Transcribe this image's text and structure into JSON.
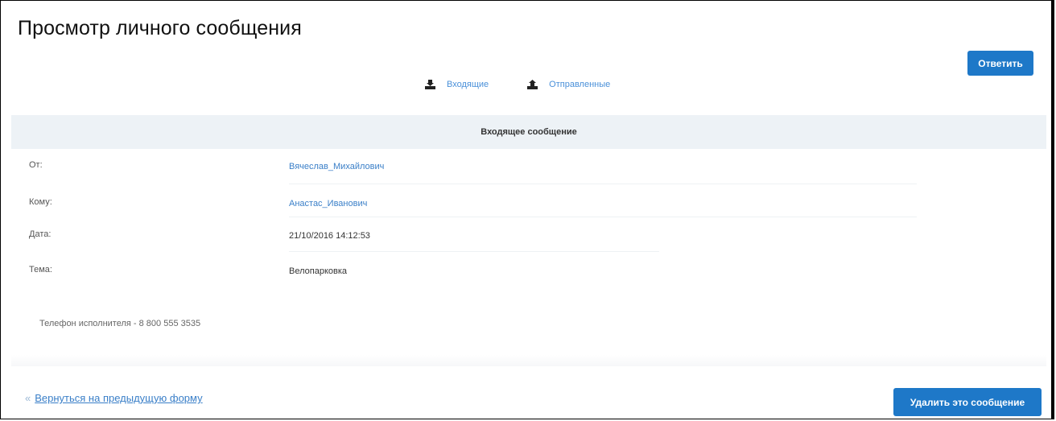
{
  "page": {
    "title": "Просмотр личного сообщения"
  },
  "actions": {
    "reply_label": "Ответить",
    "delete_label": "Удалить это сообщение",
    "back_label": "Вернуться на предыдущую форму"
  },
  "folders": {
    "inbox_label": "Входящие",
    "inbox_icon": "inbox-tray-icon",
    "sent_label": "Отправленные",
    "sent_icon": "outbox-tray-icon"
  },
  "message": {
    "header": "Входящее сообщение",
    "from_label": "От:",
    "from_value": "Вячеслав_Михайлович",
    "to_label": "Кому:",
    "to_value": "Анастас_Иванович",
    "date_label": "Дата:",
    "date_value": "21/10/2016 14:12:53",
    "subject_label": "Тема:",
    "subject_value": "Велопарковка",
    "body": "Телефон исполнителя - 8 800 555 3535"
  },
  "colors": {
    "accent": "#1e78c8",
    "link": "#3a7fc8",
    "header_bg": "#edf2f6"
  }
}
